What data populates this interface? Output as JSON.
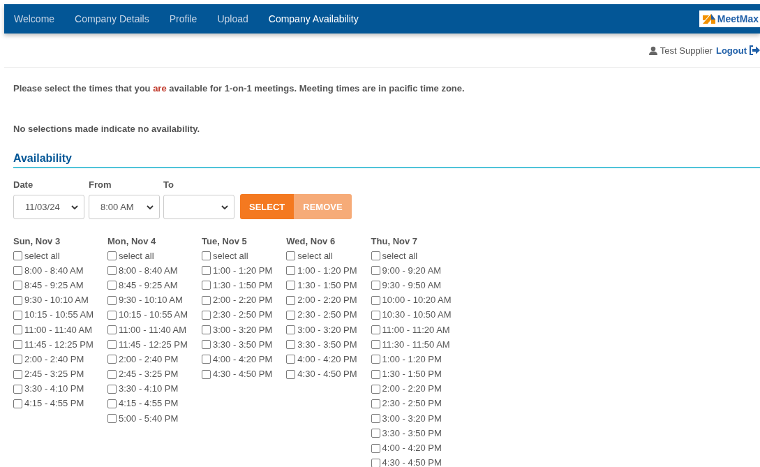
{
  "nav": {
    "items": [
      {
        "label": "Welcome",
        "selected": false
      },
      {
        "label": "Company Details",
        "selected": false
      },
      {
        "label": "Profile",
        "selected": false
      },
      {
        "label": "Upload",
        "selected": false
      },
      {
        "label": "Company Availability",
        "selected": true
      }
    ],
    "logo": "MeetMax"
  },
  "user": {
    "name": "Test Supplier",
    "logout": "Logout"
  },
  "intro": [
    {
      "text": "Please select the times that you ",
      "highlight": false
    },
    {
      "text": "are",
      "highlight": true
    },
    {
      "text": " available for 1-on-1 meetings. Meeting times are in pacific time zone.",
      "highlight": false
    }
  ],
  "note": "No selections made indicate no availability.",
  "section_title": "Availability",
  "filters": [
    {
      "label": "Date",
      "value": "11/03/24"
    },
    {
      "label": "From",
      "value": "8:00 AM"
    },
    {
      "label": "To"
    }
  ],
  "buttons": [
    {
      "label": "SELECT",
      "disabled": false
    },
    {
      "label": "REMOVE",
      "disabled": true
    }
  ],
  "days": [
    {
      "title": "Sun, Nov 3",
      "slots": [
        {
          "label": "select all",
          "checked": false
        },
        {
          "label": "8:00 - 8:40 AM",
          "checked": false
        },
        {
          "label": "8:45 - 9:25 AM",
          "checked": false
        },
        {
          "label": "9:30 - 10:10 AM",
          "checked": false
        },
        {
          "label": "10:15 - 10:55 AM",
          "checked": false
        },
        {
          "label": "11:00 - 11:40 AM",
          "checked": false
        },
        {
          "label": "11:45 - 12:25 PM",
          "checked": false
        },
        {
          "label": "2:00 - 2:40 PM",
          "checked": false
        },
        {
          "label": "2:45 - 3:25 PM",
          "checked": false
        },
        {
          "label": "3:30 - 4:10 PM",
          "checked": false
        },
        {
          "label": "4:15 - 4:55 PM",
          "checked": false
        }
      ]
    },
    {
      "title": "Mon, Nov 4",
      "slots": [
        {
          "label": "select all",
          "checked": false
        },
        {
          "label": "8:00 - 8:40 AM",
          "checked": false
        },
        {
          "label": "8:45 - 9:25 AM",
          "checked": false
        },
        {
          "label": "9:30 - 10:10 AM",
          "checked": false
        },
        {
          "label": "10:15 - 10:55 AM",
          "checked": false
        },
        {
          "label": "11:00 - 11:40 AM",
          "checked": false
        },
        {
          "label": "11:45 - 12:25 PM",
          "checked": false
        },
        {
          "label": "2:00 - 2:40 PM",
          "checked": false
        },
        {
          "label": "2:45 - 3:25 PM",
          "checked": false
        },
        {
          "label": "3:30 - 4:10 PM",
          "checked": false
        },
        {
          "label": "4:15 - 4:55 PM",
          "checked": false
        },
        {
          "label": "5:00 - 5:40 PM",
          "checked": false
        }
      ]
    },
    {
      "title": "Tue, Nov 5",
      "slots": [
        {
          "label": "select all",
          "checked": false
        },
        {
          "label": "1:00 - 1:20 PM",
          "checked": false
        },
        {
          "label": "1:30 - 1:50 PM",
          "checked": false
        },
        {
          "label": "2:00 - 2:20 PM",
          "checked": false
        },
        {
          "label": "2:30 - 2:50 PM",
          "checked": false
        },
        {
          "label": "3:00 - 3:20 PM",
          "checked": false
        },
        {
          "label": "3:30 - 3:50 PM",
          "checked": false
        },
        {
          "label": "4:00 - 4:20 PM",
          "checked": false
        },
        {
          "label": "4:30 - 4:50 PM",
          "checked": false
        }
      ]
    },
    {
      "title": "Wed, Nov 6",
      "slots": [
        {
          "label": "select all",
          "checked": false
        },
        {
          "label": "1:00 - 1:20 PM",
          "checked": false
        },
        {
          "label": "1:30 - 1:50 PM",
          "checked": false
        },
        {
          "label": "2:00 - 2:20 PM",
          "checked": false
        },
        {
          "label": "2:30 - 2:50 PM",
          "checked": false
        },
        {
          "label": "3:00 - 3:20 PM",
          "checked": false
        },
        {
          "label": "3:30 - 3:50 PM",
          "checked": false
        },
        {
          "label": "4:00 - 4:20 PM",
          "checked": false
        },
        {
          "label": "4:30 - 4:50 PM",
          "checked": false
        }
      ]
    },
    {
      "title": "Thu, Nov 7",
      "slots": [
        {
          "label": "select all",
          "checked": false
        },
        {
          "label": "9:00 - 9:20 AM",
          "checked": false
        },
        {
          "label": "9:30 - 9:50 AM",
          "checked": false
        },
        {
          "label": "10:00 - 10:20 AM",
          "checked": false
        },
        {
          "label": "10:30 - 10:50 AM",
          "checked": false
        },
        {
          "label": "11:00 - 11:20 AM",
          "checked": false
        },
        {
          "label": "11:30 - 11:50 AM",
          "checked": false
        },
        {
          "label": "1:00 - 1:20 PM",
          "checked": false
        },
        {
          "label": "1:30 - 1:50 PM",
          "checked": false
        },
        {
          "label": "2:00 - 2:20 PM",
          "checked": false
        },
        {
          "label": "2:30 - 2:50 PM",
          "checked": false
        },
        {
          "label": "3:00 - 3:20 PM",
          "checked": false
        },
        {
          "label": "3:30 - 3:50 PM",
          "checked": false
        },
        {
          "label": "4:00 - 4:20 PM",
          "checked": false
        },
        {
          "label": "4:30 - 4:50 PM",
          "checked": false
        }
      ]
    }
  ]
}
